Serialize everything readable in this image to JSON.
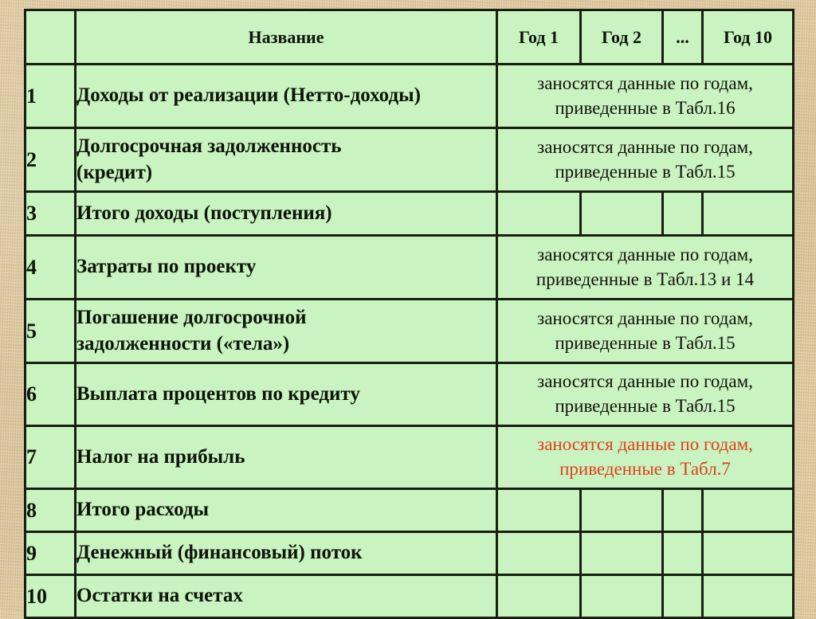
{
  "page": {
    "background_color": "#ddc49a",
    "table_fill_color": "#c9f3c0",
    "border_color": "#16200f",
    "text_color": "#0d1408",
    "highlight_color": "#e2401c"
  },
  "table": {
    "header": {
      "num_label": "",
      "name_label": "Название",
      "year_columns": [
        "Год 1",
        "Год 2",
        "...",
        "Год 10"
      ]
    },
    "rows": [
      {
        "num": "1",
        "name": "Доходы от реализации (Нетто-доходы)",
        "note": "заносятся данные по годам,\nприведенные в Табл.16",
        "note_color": "normal",
        "note_spans_years": true,
        "empty_year_cells": 0
      },
      {
        "num": "2",
        "name": "Долгосрочная задолженность\n(кредит)",
        "note": "заносятся данные по годам,\nприведенные в Табл.15",
        "note_color": "normal",
        "note_spans_years": true,
        "empty_year_cells": 0
      },
      {
        "num": "3",
        "name": "Итого доходы (поступления)",
        "note": "",
        "note_color": "normal",
        "note_spans_years": false,
        "empty_year_cells": 4
      },
      {
        "num": "4",
        "name": "Затраты по проекту",
        "note": "заносятся данные по годам,\nприведенные в Табл.13 и 14",
        "note_color": "normal",
        "note_spans_years": true,
        "empty_year_cells": 0
      },
      {
        "num": "5",
        "name": "Погашение долгосрочной\nзадолженности («тела»)",
        "note": "заносятся данные по годам,\nприведенные в Табл.15",
        "note_color": "normal",
        "note_spans_years": true,
        "empty_year_cells": 0
      },
      {
        "num": "6",
        "name": "Выплата процентов по кредиту",
        "note": "заносятся данные по годам,\nприведенные в Табл.15",
        "note_color": "normal",
        "note_spans_years": true,
        "empty_year_cells": 0
      },
      {
        "num": "7",
        "name": "Налог на прибыль",
        "note": "заносятся данные по годам,\nприведенные в Табл.7",
        "note_color": "red",
        "note_spans_years": true,
        "empty_year_cells": 0
      },
      {
        "num": "8",
        "name": "Итого расходы",
        "note": "",
        "note_color": "normal",
        "note_spans_years": false,
        "empty_year_cells": 4
      },
      {
        "num": "9",
        "name": "Денежный (финансовый) поток",
        "note": "",
        "note_color": "normal",
        "note_spans_years": false,
        "empty_year_cells": 4
      },
      {
        "num": "10",
        "name": "Остатки на счетах",
        "note": "",
        "note_color": "normal",
        "note_spans_years": false,
        "empty_year_cells": 4
      }
    ]
  }
}
